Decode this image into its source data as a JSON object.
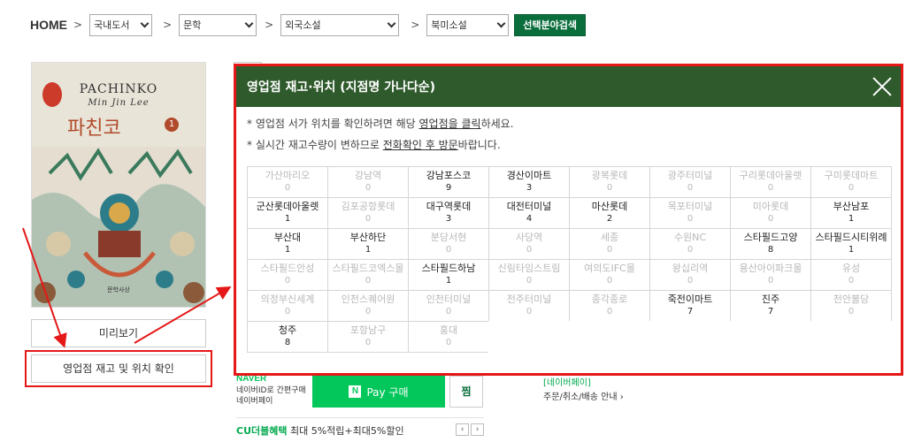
{
  "breadcrumb": {
    "home": "HOME",
    "sep": ">",
    "selects": [
      "국내도서",
      "문학",
      "외국소설",
      "북미소설"
    ],
    "search_label": "선택분야검색"
  },
  "book": {
    "title_en": "PACHINKO",
    "author_en": "Min Jin Lee",
    "title_kr": "파친코",
    "volume": "1",
    "publisher": "문학사상"
  },
  "buttons": {
    "preview": "미리보기",
    "stock": "영업점 재고 및 위치 확인"
  },
  "modal": {
    "title": "영업점 재고·위치 (지점명 가나다순)",
    "notice1": {
      "a": "* 영업점 서가 위치를 확인하려면 해당 ",
      "u": "영업점을 클릭",
      "b": "하세요."
    },
    "notice2": {
      "a": "* 실시간 재고수량이 변하므로 ",
      "u": "전화확인 후 방문",
      "b": "바랍니다."
    },
    "stores": [
      {
        "name": "가산마리오",
        "count": "0"
      },
      {
        "name": "강남역",
        "count": "0"
      },
      {
        "name": "강남포스코",
        "count": "9"
      },
      {
        "name": "경산이마트",
        "count": "3"
      },
      {
        "name": "광복롯데",
        "count": "0"
      },
      {
        "name": "광주터미널",
        "count": "0"
      },
      {
        "name": "구리롯데아울렛",
        "count": "0"
      },
      {
        "name": "구미롯데마트",
        "count": "0"
      },
      {
        "name": "군산롯데아울렛",
        "count": "1"
      },
      {
        "name": "김포공항롯데",
        "count": "0"
      },
      {
        "name": "대구역롯데",
        "count": "3"
      },
      {
        "name": "대전터미널",
        "count": "4"
      },
      {
        "name": "마산롯데",
        "count": "2"
      },
      {
        "name": "목포터미널",
        "count": "0"
      },
      {
        "name": "미아롯데",
        "count": "0"
      },
      {
        "name": "부산남포",
        "count": "1"
      },
      {
        "name": "부산대",
        "count": "1"
      },
      {
        "name": "부산하단",
        "count": "1"
      },
      {
        "name": "분당서현",
        "count": "0"
      },
      {
        "name": "사당역",
        "count": "0"
      },
      {
        "name": "세종",
        "count": "0"
      },
      {
        "name": "수원NC",
        "count": "0"
      },
      {
        "name": "스타필드고양",
        "count": "8"
      },
      {
        "name": "스타필드시티위례",
        "count": "1"
      },
      {
        "name": "스타필드안성",
        "count": "0"
      },
      {
        "name": "스타필드코엑스몰",
        "count": "0"
      },
      {
        "name": "스타필드하남",
        "count": "1"
      },
      {
        "name": "신림타임스트림",
        "count": "0"
      },
      {
        "name": "여의도IFC몰",
        "count": "0"
      },
      {
        "name": "왕십리역",
        "count": "0"
      },
      {
        "name": "용산아이파크몰",
        "count": "0"
      },
      {
        "name": "유성",
        "count": "0"
      },
      {
        "name": "의정부신세계",
        "count": "0"
      },
      {
        "name": "인천스퀘어원",
        "count": "0"
      },
      {
        "name": "인천터미널",
        "count": "0"
      },
      {
        "name": "전주터미널",
        "count": "0"
      },
      {
        "name": "종각종로",
        "count": "0"
      },
      {
        "name": "죽전이마트",
        "count": "7"
      },
      {
        "name": "진주",
        "count": "7"
      },
      {
        "name": "천안불당",
        "count": "0"
      },
      {
        "name": "청주",
        "count": "8"
      },
      {
        "name": "포항남구",
        "count": "0"
      },
      {
        "name": "홍대",
        "count": "0"
      }
    ]
  },
  "naver": {
    "logo": "NAVER",
    "line1": "네이버ID로 간편구매",
    "line2": "네이버페이",
    "pay_n": "N",
    "pay_label": "Pay 구매",
    "jjim": "찜",
    "info1": "[네이버페이]",
    "info2": "주문/취소/배송 안내"
  },
  "cu": {
    "brand": "CU더블혜택",
    "text": " 최대 5%적립+최대5%할인"
  },
  "colors": {
    "modal_header": "#2f5a2c",
    "highlight_red": "#e51717",
    "search_green": "#0a6e3c",
    "naver_green": "#03c75a"
  }
}
